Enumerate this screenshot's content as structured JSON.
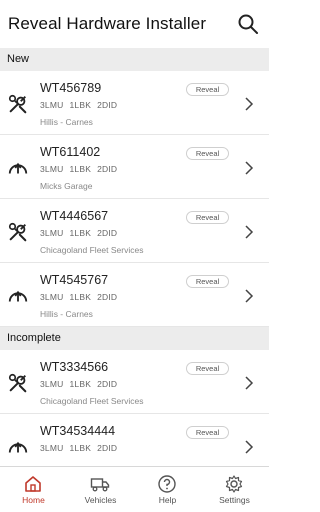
{
  "app": {
    "title": "Reveal Hardware Installer"
  },
  "sections": [
    {
      "header": "New",
      "rows": [
        {
          "id": "WT456789",
          "counts": [
            "3LMU",
            "1LBK",
            "2DID"
          ],
          "customer": "Hillis - Carnes",
          "badge": "Reveal",
          "icon": "tools-icon"
        },
        {
          "id": "WT611402",
          "counts": [
            "3LMU",
            "1LBK",
            "2DID"
          ],
          "customer": "Micks Garage",
          "badge": "Reveal",
          "icon": "gauge-icon"
        },
        {
          "id": "WT4446567",
          "counts": [
            "3LMU",
            "1LBK",
            "2DID"
          ],
          "customer": "Chicagoland Fleet Services",
          "badge": "Reveal",
          "icon": "tools-icon"
        },
        {
          "id": "WT4545767",
          "counts": [
            "3LMU",
            "1LBK",
            "2DID"
          ],
          "customer": "Hillis - Carnes",
          "badge": "Reveal",
          "icon": "gauge-icon"
        }
      ]
    },
    {
      "header": "Incomplete",
      "rows": [
        {
          "id": "WT3334566",
          "counts": [
            "3LMU",
            "1LBK",
            "2DID"
          ],
          "customer": "Chicagoland Fleet Services",
          "badge": "Reveal",
          "icon": "tools-icon"
        },
        {
          "id": "WT34534444",
          "counts": [
            "3LMU",
            "1LBK",
            "2DID"
          ],
          "customer": "",
          "badge": "Reveal",
          "icon": "gauge-icon"
        }
      ]
    }
  ],
  "nav": {
    "items": [
      {
        "label": "Home",
        "icon": "home-icon",
        "active": true
      },
      {
        "label": "Vehicles",
        "icon": "truck-icon",
        "active": false
      },
      {
        "label": "Help",
        "icon": "help-icon",
        "active": false
      },
      {
        "label": "Settings",
        "icon": "gear-icon",
        "active": false
      }
    ]
  },
  "colors": {
    "accent": "#c0392b",
    "section_bg": "#ececec",
    "text": "#222222",
    "muted": "#888888"
  }
}
